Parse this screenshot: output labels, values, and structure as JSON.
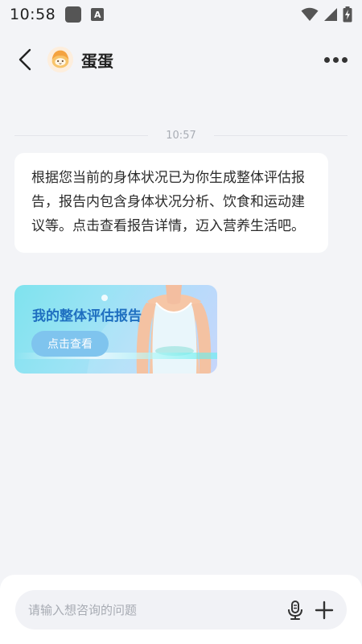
{
  "status_bar": {
    "time": "10:58",
    "a_icon_label": "A"
  },
  "header": {
    "title": "蛋蛋"
  },
  "chat": {
    "timestamp": "10:57",
    "message": "根据您当前的身体状况已为你生成整体评估报告，报告内包含身体状况分析、饮食和运动建议等。点击查看报告详情，迈入营养生活吧。",
    "report_card": {
      "title": "我的整体评估报告",
      "button_label": "点击查看"
    }
  },
  "input": {
    "placeholder": "请输入想咨询的问题",
    "value": ""
  },
  "colors": {
    "background": "#f3f4f7",
    "report_title": "#1f6fc0",
    "report_button": "#7fc4ee"
  }
}
